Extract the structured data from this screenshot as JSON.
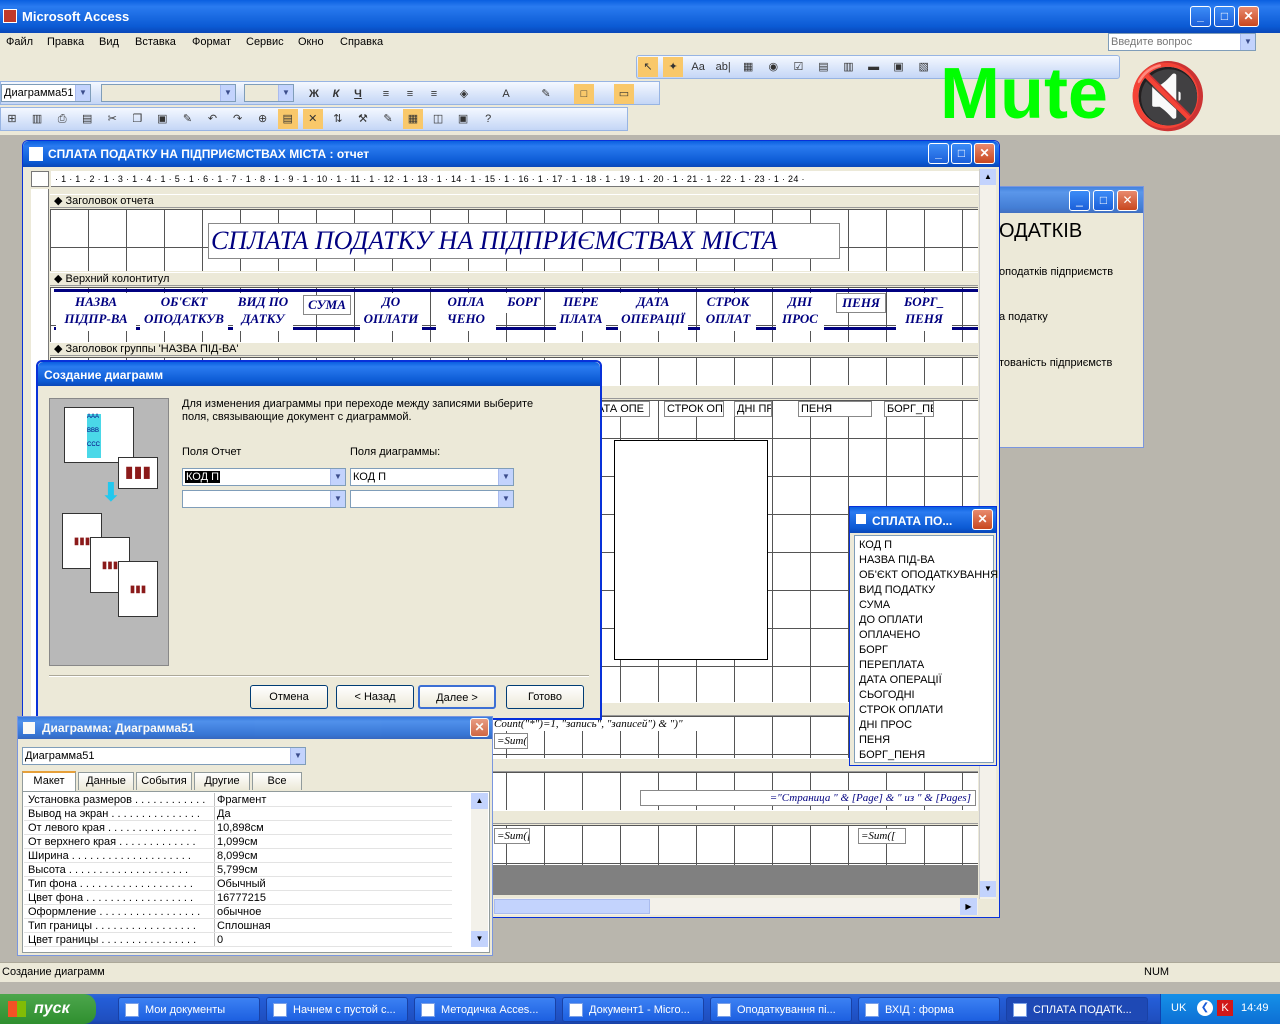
{
  "app": {
    "title": "Microsoft Access",
    "question_placeholder": "Введите вопрос",
    "status_left": "Создание диаграмм",
    "status_num": "NUM",
    "min": "_",
    "max": "□",
    "close": "✕"
  },
  "menu": [
    "Файл",
    "Правка",
    "Вид",
    "Вставка",
    "Формат",
    "Сервис",
    "Окно",
    "Справка"
  ],
  "toolbar": {
    "object_box": "Диаграмма51",
    "bold": "Ж",
    "italic": "К",
    "underline": "Ч"
  },
  "overlay": {
    "mute_text": "Mute"
  },
  "report": {
    "title": "СПЛАТА ПОДАТКУ НА ПІДПРИЄМСТВАХ МІСТА : отчет",
    "ruler": "· 1 · 1 · 2 · 1 · 3 · 1 · 4 · 1 · 5 · 1 · 6 · 1 · 7 · 1 · 8 · 1 · 9 · 1 · 10 · 1 · 11 · 1 · 12 · 1 · 13 · 1 · 14 · 1 · 15 · 1 · 16 · 1 · 17 · 1 · 18 · 1 · 19 · 1 · 20 · 1 · 21 · 1 · 22 · 1 · 23 · 1 · 24 ·",
    "section_report_header": "Заголовок отчета",
    "section_page_header": "Верхний колонтитул",
    "section_group_header": "Заголовок группы 'НАЗВА ПІД-ВА'",
    "heading": "СПЛАТА ПОДАТКУ НА ПІДПРИЄМСТВАХ МІСТА",
    "columns": [
      "НАЗВА\nПІДПР-ВА",
      "ОБ'ЄКТ\nОПОДАТКУВ",
      "ВИД ПО\nДАТКУ",
      "СУМА",
      "ДО\nОПЛАТИ",
      "ОПЛА\nЧЕНО",
      "БОРГ",
      "ПЕРЕ\nПЛАТА",
      "ДАТА\nОПЕРАЦІЇ",
      "СТРОК\nОПЛАТ",
      "ДНІ\nПРОС",
      "ПЕНЯ",
      "БОРГ_\nПЕНЯ"
    ],
    "detail_fields": [
      "АТА ОПЕ",
      "СТРОК ОПЛ",
      "ДНІ ПР",
      "ПЕНЯ",
      "БОРГ_ПЕ"
    ],
    "footer_expr": "Count(\"*\")=1, \"запись\", \"записей\") & \")\"",
    "sum1": "=Sum([",
    "sum2": "=Sum([",
    "sum3": "=Sum([",
    "page_expr": "=\"Страница \" & [Page] & \" из \" & [Pages]"
  },
  "back_window": {
    "heading": "ОДАТКІВ",
    "l1": "оподатків підприємств",
    "l2": "а податку",
    "l3": "тованість підприємств"
  },
  "field_list": {
    "title": "СПЛАТА ПО...",
    "items": [
      "КОД П",
      "НАЗВА ПІД-ВА",
      "ОБ'ЄКТ ОПОДАТКУВАННЯ",
      "ВИД ПОДАТКУ",
      "СУМА",
      "ДО ОПЛАТИ",
      "ОПЛАЧЕНО",
      "БОРГ",
      "ПЕРЕПЛАТА",
      "ДАТА ОПЕРАЦІЇ",
      "СЬОГОДНІ",
      "СТРОК ОПЛАТИ",
      "ДНІ ПРОС",
      "ПЕНЯ",
      "БОРГ_ПЕНЯ"
    ]
  },
  "wizard": {
    "title": "Создание диаграмм",
    "instruction": "Для изменения диаграммы при переходе между записями выберите поля, связывающие документ с диаграммой.",
    "label_report": "Поля Отчет",
    "label_chart": "Поля диаграммы:",
    "report_field1": "КОД П",
    "chart_field1": "КОД П",
    "cancel": "Отмена",
    "back": "< Назад",
    "next": "Далее >",
    "finish": "Готово",
    "tile_aaa": "AAA",
    "tile_bbb": "BBB",
    "tile_ccc": "CCC"
  },
  "props": {
    "title": "Диаграмма: Диаграмма51",
    "object": "Диаграмма51",
    "tabs": [
      "Макет",
      "Данные",
      "События",
      "Другие",
      "Все"
    ],
    "rows": [
      {
        "n": "Установка размеров . . . . . . . . . . . .",
        "v": "Фрагмент"
      },
      {
        "n": "Вывод на экран . . . . . . . . . . . . . . .",
        "v": "Да"
      },
      {
        "n": "От левого края . . . . . . . . . . . . . . .",
        "v": "10,898см"
      },
      {
        "n": "От верхнего края . . . . . . . . . . . . .",
        "v": "1,099см"
      },
      {
        "n": "Ширина . . . . . . . . . . . . . . . . . . . .",
        "v": "8,099см"
      },
      {
        "n": "Высота . . . . . . . . . . . . . . . . . . . .",
        "v": "5,799см"
      },
      {
        "n": "Тип фона . . . . . . . . . . . . . . . . . . .",
        "v": "Обычный"
      },
      {
        "n": "Цвет фона . . . . . . . . . . . . . . . . . .",
        "v": "16777215"
      },
      {
        "n": "Оформление . . . . . . . . . . . . . . . . .",
        "v": "обычное"
      },
      {
        "n": "Тип границы . . . . . . . . . . . . . . . . .",
        "v": "Сплошная"
      },
      {
        "n": "Цвет границы . . . . . . . . . . . . . . . .",
        "v": "0"
      }
    ]
  },
  "taskbar": {
    "start": "пуск",
    "items": [
      "Мои документы",
      "Начнем с пустой с...",
      "Методичка Acces...",
      "Документ1 - Micro...",
      "Оподаткування пі...",
      "ВХІД : форма",
      "СПЛАТА ПОДАТК..."
    ],
    "lang": "UK",
    "clock": "14:49"
  }
}
